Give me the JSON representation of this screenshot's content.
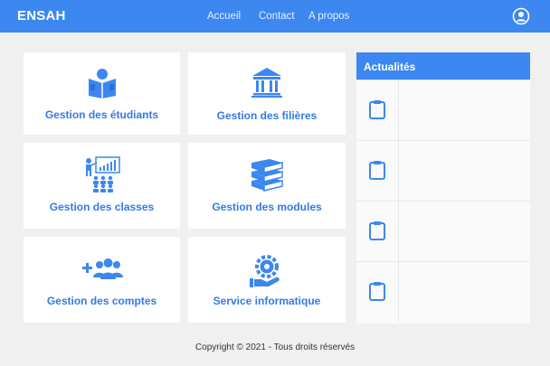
{
  "navbar": {
    "brand": "ENSAH",
    "links": [
      "Accueil",
      "Contact",
      "A propos"
    ],
    "user_icon": "user-circle-icon"
  },
  "cards": [
    {
      "label": "Gestion des étudiants",
      "icon": "student-reading-icon"
    },
    {
      "label": "Gestion des filières",
      "icon": "institution-building-icon"
    },
    {
      "label": "Gestion des classes",
      "icon": "classroom-presentation-icon"
    },
    {
      "label": "Gestion des modules",
      "icon": "book-stack-icon"
    },
    {
      "label": "Gestion des comptes",
      "icon": "add-users-icon"
    },
    {
      "label": "Service informatique",
      "icon": "it-service-gear-icon"
    }
  ],
  "news": {
    "title": "Actualités",
    "rows": 4,
    "row_icon": "clipboard-icon"
  },
  "footer": {
    "copyright": "Copyright © 2021 - Tous droits réservés"
  },
  "colors": {
    "primary": "#3c87f0",
    "label": "#3579e6",
    "background": "#f0f0f0"
  }
}
